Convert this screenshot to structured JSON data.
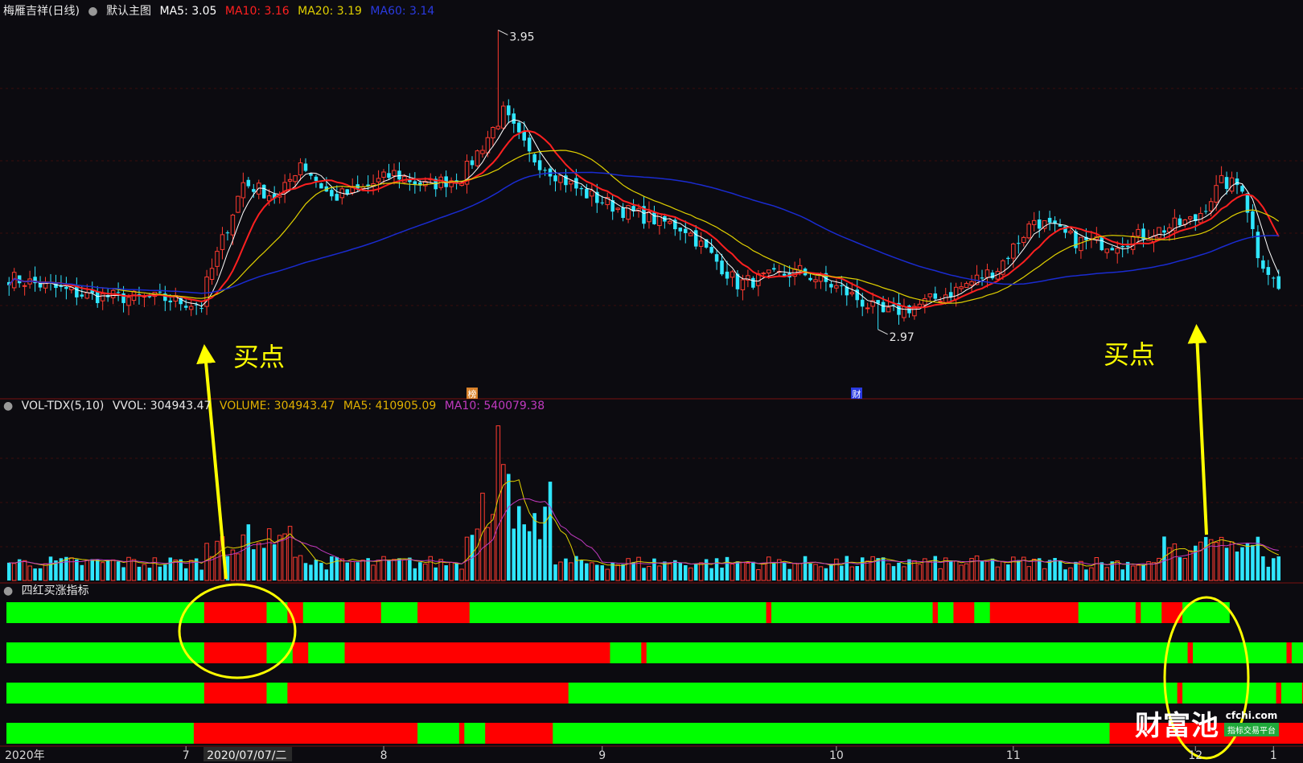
{
  "header": {
    "stock": "梅雁吉祥(日线)",
    "view": "默认主图",
    "ma5": "MA5: 3.05",
    "ma10": "MA10: 3.16",
    "ma20": "MA20: 3.19",
    "ma60": "MA60: 3.14"
  },
  "vol_header": {
    "name": "VOL-TDX(5,10)",
    "vvol": "VVOL: 304943.47",
    "volume": "VOLUME: 304943.47",
    "ma5": "MA5: 410905.09",
    "ma10": "MA10: 540079.38"
  },
  "indicator_header": {
    "name": "四红买涨指标"
  },
  "annotations": {
    "buy_left": "买点",
    "buy_right": "买点",
    "high_label": "3.95",
    "low_label": "2.97",
    "bang": "榜",
    "cai": "财"
  },
  "x_axis": {
    "year_label": "2020年",
    "cursor_date": "2020/07/07/二",
    "months": [
      "7",
      "8",
      "9",
      "10",
      "11",
      "12",
      "1"
    ]
  },
  "watermark": {
    "text": "财富池",
    "url": "cfchi.com",
    "tag": "指标交易平台"
  },
  "colors": {
    "up": "#ff3b30",
    "down": "#2fe6ff",
    "ma5": "#ffffff",
    "ma10": "#ff2020",
    "ma20": "#e0d000",
    "ma60": "#1a2bd0",
    "vol_ma10": "#c03ac0",
    "bar_green": "#00ff00",
    "bar_red": "#ff0000",
    "annotation": "#ffff00"
  },
  "chart_data": [
    {
      "type": "candlestick",
      "title": "梅雁吉祥(日线)",
      "period": "2020-05 to 2021-01",
      "marked_high": 3.95,
      "marked_low": 2.97,
      "series": [
        {
          "name": "MA5",
          "last": 3.05
        },
        {
          "name": "MA10",
          "last": 3.16
        },
        {
          "name": "MA20",
          "last": 3.19
        },
        {
          "name": "MA60",
          "last": 3.14
        }
      ]
    },
    {
      "type": "bar",
      "title": "VOL-TDX(5,10)",
      "last_volume": 304943.47,
      "series": [
        {
          "name": "MA5",
          "last": 410905.09
        },
        {
          "name": "MA10",
          "last": 540079.38
        }
      ]
    },
    {
      "type": "heatmap",
      "title": "四红买涨指标",
      "rows": [
        [
          "G",
          "G",
          "G",
          "G",
          "G",
          "G",
          "G",
          "G",
          "G",
          "G",
          "G",
          "G",
          "G",
          "G",
          "G",
          "G",
          "G",
          "G",
          "G",
          "G",
          "G",
          "G",
          "G",
          "G",
          "G",
          "G",
          "G",
          "G",
          "G",
          "G",
          "G",
          "G",
          "G",
          "G",
          "G",
          "G",
          "G",
          "G",
          "R",
          "R",
          "R",
          "R",
          "R",
          "R",
          "R",
          "R",
          "R",
          "R",
          "R",
          "R",
          "G",
          "G",
          "G",
          "G",
          "R",
          "R",
          "R",
          "G",
          "G",
          "G",
          "G",
          "G",
          "G",
          "G",
          "G",
          "R",
          "R",
          "R",
          "R",
          "R",
          "R",
          "R",
          "G",
          "G",
          "G",
          "G",
          "G",
          "G",
          "G",
          "R",
          "R",
          "R",
          "R",
          "R",
          "R",
          "R",
          "R",
          "R",
          "R",
          "G",
          "G",
          "G",
          "G",
          "G",
          "G",
          "G",
          "G",
          "G",
          "G",
          "G",
          "G",
          "G",
          "G",
          "G",
          "G",
          "G",
          "G",
          "G",
          "G",
          "G",
          "G",
          "G",
          "G",
          "G",
          "G",
          "G",
          "G",
          "G",
          "G",
          "G",
          "G",
          "G",
          "G",
          "G",
          "G",
          "G",
          "G",
          "G",
          "G",
          "G",
          "G",
          "G",
          "G",
          "G",
          "G",
          "G",
          "G",
          "G",
          "G",
          "G",
          "G",
          "G",
          "G",
          "G",
          "G",
          "G",
          "R",
          "G",
          "G",
          "G",
          "G",
          "G",
          "G",
          "G",
          "G",
          "G",
          "G",
          "G",
          "G",
          "G",
          "G",
          "G",
          "G",
          "G",
          "G",
          "G",
          "G",
          "G",
          "G",
          "G",
          "G",
          "G",
          "G",
          "G",
          "G",
          "G",
          "G",
          "G",
          "R",
          "G",
          "G",
          "G",
          "R",
          "R",
          "R",
          "R",
          "G",
          "G",
          "G",
          "R",
          "R",
          "R",
          "R",
          "R",
          "R",
          "R",
          "R",
          "R",
          "R",
          "R",
          "R",
          "R",
          "R",
          "R",
          "R",
          "R",
          "G",
          "G",
          "G",
          "G",
          "G",
          "G",
          "G",
          "G",
          "G",
          "G",
          "G",
          "R",
          "G",
          "G",
          "G",
          "G",
          "R",
          "R",
          "R",
          "R",
          "G",
          "G",
          "G",
          "G",
          "G",
          "G",
          "G",
          "G",
          "G"
        ],
        [
          "G",
          "G",
          "G",
          "G",
          "G",
          "G",
          "G",
          "G",
          "G",
          "G",
          "G",
          "G",
          "G",
          "G",
          "G",
          "G",
          "G",
          "G",
          "G",
          "G",
          "G",
          "G",
          "G",
          "G",
          "G",
          "G",
          "G",
          "G",
          "G",
          "G",
          "G",
          "G",
          "G",
          "G",
          "G",
          "G",
          "G",
          "G",
          "R",
          "R",
          "R",
          "R",
          "R",
          "R",
          "R",
          "R",
          "R",
          "R",
          "R",
          "R",
          "G",
          "G",
          "G",
          "G",
          "G",
          "R",
          "R",
          "R",
          "G",
          "G",
          "G",
          "G",
          "G",
          "G",
          "G",
          "R",
          "R",
          "R",
          "R",
          "R",
          "R",
          "R",
          "R",
          "R",
          "R",
          "R",
          "R",
          "R",
          "R",
          "R",
          "R",
          "R",
          "R",
          "R",
          "R",
          "R",
          "R",
          "R",
          "R",
          "R",
          "R",
          "R",
          "R",
          "R",
          "R",
          "R",
          "R",
          "R",
          "R",
          "R",
          "R",
          "R",
          "R",
          "R",
          "R",
          "R",
          "R",
          "R",
          "R",
          "R",
          "R",
          "R",
          "R",
          "R",
          "R",
          "R",
          "G",
          "G",
          "G",
          "G",
          "G",
          "G",
          "R",
          "G",
          "G",
          "G",
          "G",
          "G",
          "G",
          "G",
          "G",
          "G",
          "G",
          "G",
          "G",
          "G",
          "G",
          "G",
          "G",
          "G",
          "G",
          "G",
          "G",
          "G",
          "G",
          "G",
          "G",
          "G",
          "G",
          "G",
          "G",
          "G",
          "G",
          "G",
          "G",
          "G",
          "G",
          "G",
          "G",
          "G",
          "G",
          "G",
          "G",
          "G",
          "G",
          "G",
          "G",
          "G",
          "G",
          "G",
          "G",
          "G",
          "G",
          "G",
          "G",
          "G",
          "G",
          "G",
          "G",
          "G",
          "G",
          "G",
          "G",
          "G",
          "G",
          "G",
          "G",
          "G",
          "G",
          "G",
          "G",
          "G",
          "G",
          "G",
          "G",
          "G",
          "G",
          "G",
          "G",
          "G",
          "G",
          "G",
          "G",
          "G",
          "G",
          "G",
          "G",
          "G",
          "G",
          "G",
          "G",
          "G",
          "G",
          "G",
          "G",
          "G",
          "G",
          "G",
          "G",
          "G",
          "G",
          "G",
          "G",
          "G",
          "G",
          "G",
          "G",
          "R",
          "G",
          "G",
          "G",
          "G",
          "G",
          "G",
          "G",
          "G",
          "G",
          "G",
          "G",
          "G",
          "G",
          "G",
          "G",
          "G",
          "G",
          "G",
          "R",
          "G",
          "G",
          "G",
          "G",
          "R",
          "R",
          "R",
          "R",
          "R",
          "R",
          "G",
          "G",
          "G",
          "G",
          "G",
          "G",
          "G",
          "G",
          "G",
          "G"
        ],
        [
          "G",
          "G",
          "G",
          "G",
          "G",
          "G",
          "G",
          "G",
          "G",
          "G",
          "G",
          "G",
          "G",
          "G",
          "G",
          "G",
          "G",
          "G",
          "G",
          "G",
          "G",
          "G",
          "G",
          "G",
          "G",
          "G",
          "G",
          "G",
          "G",
          "G",
          "G",
          "G",
          "G",
          "G",
          "G",
          "G",
          "G",
          "G",
          "R",
          "R",
          "R",
          "R",
          "R",
          "R",
          "R",
          "R",
          "R",
          "R",
          "R",
          "R",
          "G",
          "G",
          "G",
          "G",
          "R",
          "R",
          "R",
          "R",
          "R",
          "R",
          "R",
          "R",
          "R",
          "R",
          "R",
          "R",
          "R",
          "R",
          "R",
          "R",
          "R",
          "R",
          "R",
          "R",
          "R",
          "R",
          "R",
          "R",
          "R",
          "R",
          "R",
          "R",
          "R",
          "R",
          "R",
          "R",
          "R",
          "R",
          "R",
          "R",
          "R",
          "R",
          "R",
          "R",
          "R",
          "R",
          "R",
          "R",
          "R",
          "R",
          "R",
          "R",
          "R",
          "R",
          "R",
          "R",
          "R",
          "R",
          "G",
          "G",
          "G",
          "G",
          "G",
          "G",
          "G",
          "G",
          "G",
          "G",
          "G",
          "G",
          "G",
          "G",
          "G",
          "G",
          "G",
          "G",
          "G",
          "G",
          "G",
          "G",
          "G",
          "G",
          "G",
          "G",
          "G",
          "G",
          "G",
          "G",
          "G",
          "G",
          "G",
          "G",
          "G",
          "G",
          "G",
          "G",
          "G",
          "G",
          "G",
          "G",
          "G",
          "G",
          "G",
          "G",
          "G",
          "G",
          "G",
          "G",
          "G",
          "G",
          "G",
          "G",
          "G",
          "G",
          "G",
          "G",
          "G",
          "G",
          "G",
          "G",
          "G",
          "G",
          "G",
          "G",
          "G",
          "G",
          "G",
          "G",
          "G",
          "G",
          "G",
          "G",
          "G",
          "G",
          "G",
          "G",
          "G",
          "G",
          "G",
          "G",
          "G",
          "G",
          "G",
          "G",
          "G",
          "G",
          "G",
          "G",
          "G",
          "G",
          "G",
          "G",
          "G",
          "G",
          "G",
          "G",
          "G",
          "G",
          "G",
          "G",
          "G",
          "G",
          "G",
          "G",
          "G",
          "G",
          "G",
          "G",
          "G",
          "G",
          "G",
          "G",
          "G",
          "G",
          "G",
          "R",
          "G",
          "G",
          "G",
          "G",
          "G",
          "G",
          "G",
          "G",
          "G",
          "G",
          "G",
          "G",
          "G",
          "G",
          "G",
          "G",
          "G",
          "G",
          "R",
          "G",
          "G",
          "G",
          "G",
          "R",
          "R",
          "R",
          "R",
          "R",
          "R",
          "G",
          "G",
          "G",
          "G",
          "G",
          "G",
          "G",
          "G",
          "G",
          "G"
        ],
        [
          "G",
          "G",
          "G",
          "G",
          "G",
          "G",
          "G",
          "G",
          "G",
          "G",
          "G",
          "G",
          "G",
          "G",
          "G",
          "G",
          "G",
          "G",
          "G",
          "G",
          "G",
          "G",
          "G",
          "G",
          "G",
          "G",
          "G",
          "G",
          "G",
          "G",
          "G",
          "G",
          "G",
          "G",
          "G",
          "G",
          "R",
          "R",
          "R",
          "R",
          "R",
          "R",
          "R",
          "R",
          "R",
          "R",
          "R",
          "R",
          "R",
          "R",
          "R",
          "R",
          "R",
          "R",
          "R",
          "R",
          "R",
          "R",
          "R",
          "R",
          "R",
          "R",
          "R",
          "R",
          "R",
          "R",
          "R",
          "R",
          "R",
          "R",
          "R",
          "R",
          "R",
          "R",
          "R",
          "R",
          "R",
          "R",
          "R",
          "G",
          "G",
          "G",
          "G",
          "G",
          "G",
          "G",
          "G",
          "R",
          "G",
          "G",
          "G",
          "G",
          "R",
          "R",
          "R",
          "R",
          "R",
          "R",
          "R",
          "R",
          "R",
          "R",
          "R",
          "R",
          "R",
          "G",
          "G",
          "G",
          "G",
          "G",
          "G",
          "G",
          "G",
          "G",
          "G",
          "G",
          "G",
          "G",
          "G",
          "G",
          "G",
          "G",
          "G",
          "G",
          "G",
          "G",
          "G",
          "G",
          "G",
          "G",
          "G",
          "G",
          "G",
          "G",
          "G",
          "G",
          "G",
          "G",
          "G",
          "G",
          "G",
          "G",
          "G",
          "G",
          "G",
          "G",
          "G",
          "G",
          "G",
          "G",
          "G",
          "G",
          "G",
          "G",
          "G",
          "G",
          "G",
          "G",
          "G",
          "G",
          "G",
          "G",
          "G",
          "G",
          "G",
          "G",
          "G",
          "G",
          "G",
          "G",
          "G",
          "G",
          "G",
          "G",
          "G",
          "G",
          "G",
          "G",
          "G",
          "G",
          "G",
          "G",
          "G",
          "G",
          "G",
          "G",
          "G",
          "G",
          "G",
          "G",
          "G",
          "G",
          "G",
          "G",
          "G",
          "G",
          "G",
          "G",
          "G",
          "G",
          "G",
          "G",
          "G",
          "G",
          "G",
          "G",
          "G",
          "G",
          "G",
          "G",
          "G",
          "G",
          "R",
          "R",
          "R",
          "R",
          "R",
          "R",
          "R",
          "R",
          "R",
          "R",
          "R",
          "R",
          "R",
          "R",
          "R",
          "R",
          "R",
          "R",
          "R",
          "R",
          "R",
          "R",
          "R",
          "R",
          "R",
          "R",
          "R",
          "R",
          "R",
          "R",
          "R",
          "R",
          "R",
          "R",
          "R",
          "R",
          "R",
          "R",
          "R",
          "R",
          "R",
          "R",
          "R",
          "R",
          "R",
          "R",
          "R",
          "R"
        ]
      ]
    }
  ]
}
